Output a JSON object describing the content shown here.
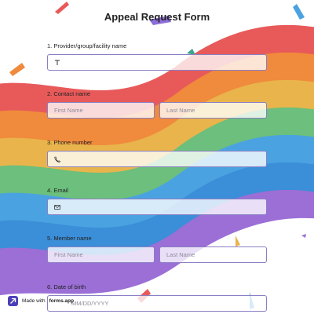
{
  "form": {
    "title": "Appeal Request Form",
    "questions": [
      {
        "label": "1. Provider/group/facility name",
        "icon": "text-icon",
        "placeholder": ""
      },
      {
        "label": "2. Contact name",
        "first_placeholder": "First Name",
        "last_placeholder": "Last Name"
      },
      {
        "label": "3. Phone number",
        "icon": "phone-icon",
        "placeholder": ""
      },
      {
        "label": "4. Email",
        "icon": "email-icon",
        "placeholder": ""
      },
      {
        "label": "5. Member name",
        "first_placeholder": "First Name",
        "last_placeholder": "Last Name"
      },
      {
        "label": "6. Date of birth",
        "placeholder": "MM/DD/YYYY"
      }
    ]
  },
  "branding": {
    "made_with": "Made with",
    "brand": "forms.app"
  },
  "colors": {
    "accent": "#8a7fc4",
    "brand": "#4b3fb8",
    "rainbow": [
      "#e85a5a",
      "#f08a3c",
      "#e9b44c",
      "#6cbf7c",
      "#4aa3e0",
      "#3b8ed8",
      "#9b6fd6"
    ]
  }
}
